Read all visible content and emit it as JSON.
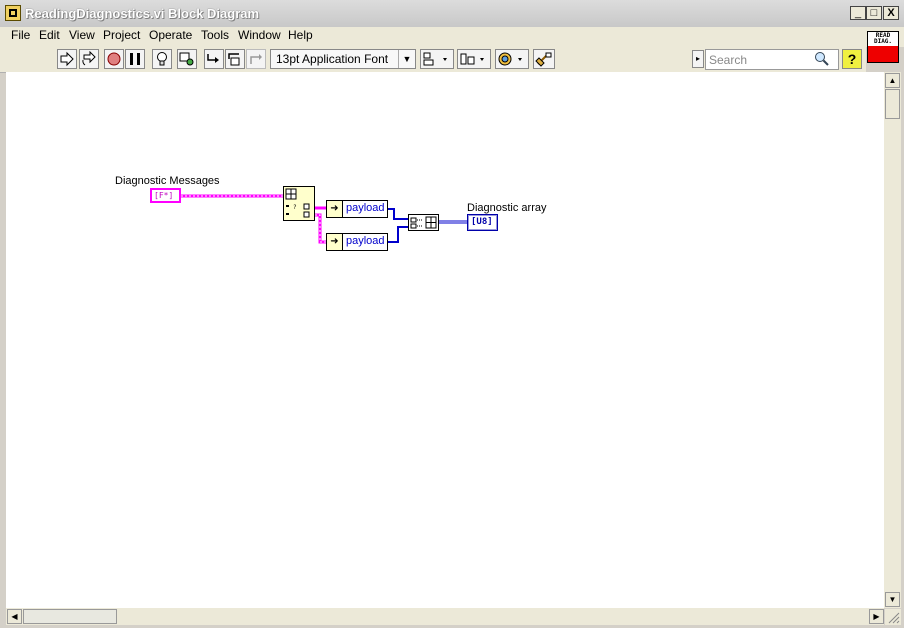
{
  "window": {
    "title": "ReadingDiagnostics.vi Block Diagram",
    "buttons": {
      "minimize": "_",
      "maximize": "□",
      "close": "X"
    }
  },
  "menu": [
    "File",
    "Edit",
    "View",
    "Project",
    "Operate",
    "Tools",
    "Window",
    "Help"
  ],
  "toolbar": {
    "font": "13pt Application Font",
    "search_placeholder": "Search",
    "help": "?",
    "vi_icon_text": "READ DIAG."
  },
  "diagram": {
    "input_label": "Diagnostic Messages",
    "input_terminal": "[F*]",
    "unbundle_field_1": "payload",
    "unbundle_field_2": "payload",
    "output_label": "Diagnostic array",
    "output_terminal": "[U8]"
  },
  "colors": {
    "cluster_wire": "#ff00ff",
    "u8_wire": "#0000ff",
    "canvas": "#ffffff",
    "chrome": "#ece9d8"
  }
}
